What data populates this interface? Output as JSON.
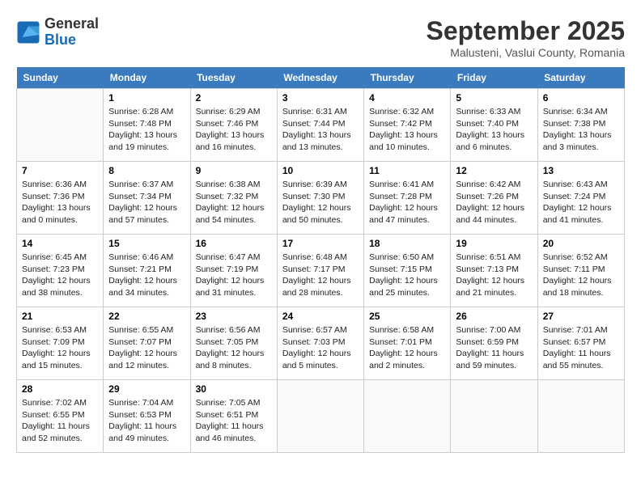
{
  "header": {
    "logo_line1": "General",
    "logo_line2": "Blue",
    "month": "September 2025",
    "location": "Malusteni, Vaslui County, Romania"
  },
  "weekdays": [
    "Sunday",
    "Monday",
    "Tuesday",
    "Wednesday",
    "Thursday",
    "Friday",
    "Saturday"
  ],
  "weeks": [
    [
      {
        "day": "",
        "content": ""
      },
      {
        "day": "1",
        "content": "Sunrise: 6:28 AM\nSunset: 7:48 PM\nDaylight: 13 hours\nand 19 minutes."
      },
      {
        "day": "2",
        "content": "Sunrise: 6:29 AM\nSunset: 7:46 PM\nDaylight: 13 hours\nand 16 minutes."
      },
      {
        "day": "3",
        "content": "Sunrise: 6:31 AM\nSunset: 7:44 PM\nDaylight: 13 hours\nand 13 minutes."
      },
      {
        "day": "4",
        "content": "Sunrise: 6:32 AM\nSunset: 7:42 PM\nDaylight: 13 hours\nand 10 minutes."
      },
      {
        "day": "5",
        "content": "Sunrise: 6:33 AM\nSunset: 7:40 PM\nDaylight: 13 hours\nand 6 minutes."
      },
      {
        "day": "6",
        "content": "Sunrise: 6:34 AM\nSunset: 7:38 PM\nDaylight: 13 hours\nand 3 minutes."
      }
    ],
    [
      {
        "day": "7",
        "content": "Sunrise: 6:36 AM\nSunset: 7:36 PM\nDaylight: 13 hours\nand 0 minutes."
      },
      {
        "day": "8",
        "content": "Sunrise: 6:37 AM\nSunset: 7:34 PM\nDaylight: 12 hours\nand 57 minutes."
      },
      {
        "day": "9",
        "content": "Sunrise: 6:38 AM\nSunset: 7:32 PM\nDaylight: 12 hours\nand 54 minutes."
      },
      {
        "day": "10",
        "content": "Sunrise: 6:39 AM\nSunset: 7:30 PM\nDaylight: 12 hours\nand 50 minutes."
      },
      {
        "day": "11",
        "content": "Sunrise: 6:41 AM\nSunset: 7:28 PM\nDaylight: 12 hours\nand 47 minutes."
      },
      {
        "day": "12",
        "content": "Sunrise: 6:42 AM\nSunset: 7:26 PM\nDaylight: 12 hours\nand 44 minutes."
      },
      {
        "day": "13",
        "content": "Sunrise: 6:43 AM\nSunset: 7:24 PM\nDaylight: 12 hours\nand 41 minutes."
      }
    ],
    [
      {
        "day": "14",
        "content": "Sunrise: 6:45 AM\nSunset: 7:23 PM\nDaylight: 12 hours\nand 38 minutes."
      },
      {
        "day": "15",
        "content": "Sunrise: 6:46 AM\nSunset: 7:21 PM\nDaylight: 12 hours\nand 34 minutes."
      },
      {
        "day": "16",
        "content": "Sunrise: 6:47 AM\nSunset: 7:19 PM\nDaylight: 12 hours\nand 31 minutes."
      },
      {
        "day": "17",
        "content": "Sunrise: 6:48 AM\nSunset: 7:17 PM\nDaylight: 12 hours\nand 28 minutes."
      },
      {
        "day": "18",
        "content": "Sunrise: 6:50 AM\nSunset: 7:15 PM\nDaylight: 12 hours\nand 25 minutes."
      },
      {
        "day": "19",
        "content": "Sunrise: 6:51 AM\nSunset: 7:13 PM\nDaylight: 12 hours\nand 21 minutes."
      },
      {
        "day": "20",
        "content": "Sunrise: 6:52 AM\nSunset: 7:11 PM\nDaylight: 12 hours\nand 18 minutes."
      }
    ],
    [
      {
        "day": "21",
        "content": "Sunrise: 6:53 AM\nSunset: 7:09 PM\nDaylight: 12 hours\nand 15 minutes."
      },
      {
        "day": "22",
        "content": "Sunrise: 6:55 AM\nSunset: 7:07 PM\nDaylight: 12 hours\nand 12 minutes."
      },
      {
        "day": "23",
        "content": "Sunrise: 6:56 AM\nSunset: 7:05 PM\nDaylight: 12 hours\nand 8 minutes."
      },
      {
        "day": "24",
        "content": "Sunrise: 6:57 AM\nSunset: 7:03 PM\nDaylight: 12 hours\nand 5 minutes."
      },
      {
        "day": "25",
        "content": "Sunrise: 6:58 AM\nSunset: 7:01 PM\nDaylight: 12 hours\nand 2 minutes."
      },
      {
        "day": "26",
        "content": "Sunrise: 7:00 AM\nSunset: 6:59 PM\nDaylight: 11 hours\nand 59 minutes."
      },
      {
        "day": "27",
        "content": "Sunrise: 7:01 AM\nSunset: 6:57 PM\nDaylight: 11 hours\nand 55 minutes."
      }
    ],
    [
      {
        "day": "28",
        "content": "Sunrise: 7:02 AM\nSunset: 6:55 PM\nDaylight: 11 hours\nand 52 minutes."
      },
      {
        "day": "29",
        "content": "Sunrise: 7:04 AM\nSunset: 6:53 PM\nDaylight: 11 hours\nand 49 minutes."
      },
      {
        "day": "30",
        "content": "Sunrise: 7:05 AM\nSunset: 6:51 PM\nDaylight: 11 hours\nand 46 minutes."
      },
      {
        "day": "",
        "content": ""
      },
      {
        "day": "",
        "content": ""
      },
      {
        "day": "",
        "content": ""
      },
      {
        "day": "",
        "content": ""
      }
    ]
  ]
}
